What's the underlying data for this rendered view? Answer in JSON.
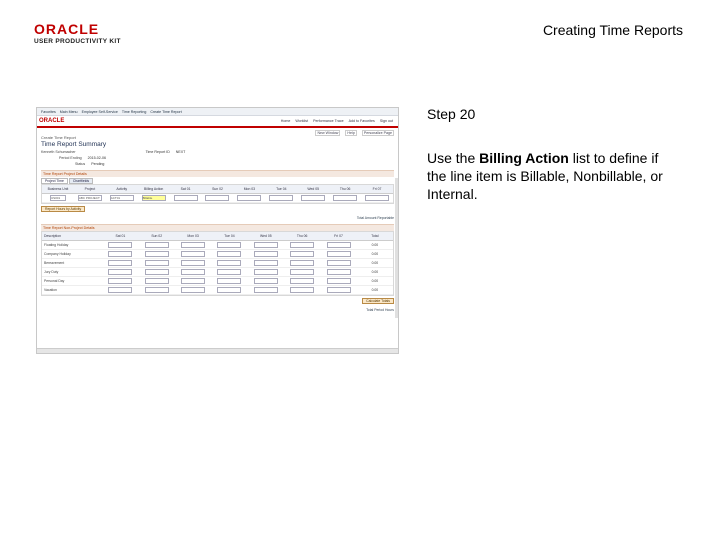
{
  "slide": {
    "title": "Creating Time Reports",
    "logo_word": "ORACLE",
    "logo_sub": "USER PRODUCTIVITY KIT",
    "step_label": "Step 20",
    "instruction_before": "Use the ",
    "instruction_bold": "Billing Action",
    "instruction_after": " list to define if the line item is Billable, Nonbillable, or Internal."
  },
  "app": {
    "topnav": [
      "Favorites",
      "Main Menu",
      "Employee Self-Service",
      "Time Reporting",
      "Create Time Report"
    ],
    "logo": "ORACLE",
    "menu_links": [
      "Home",
      "Worklist",
      "Performance Trace",
      "Add to Favorites",
      "Sign out"
    ],
    "util_links": [
      "New Window",
      "Help",
      "Personalize Page"
    ],
    "page_subtitle": "Create Time Report",
    "page_title": "Time Report Summary",
    "employee_label": "Kenneth Schumacher",
    "report_id_label": "Time Report ID",
    "report_id_value": "NEXT",
    "date_label": "Period Ending",
    "date_value": "2015-02-06",
    "status_label": "Status",
    "status_value": "Pending",
    "section1": "Time Report Project Details",
    "tabs": [
      "Project Time",
      "Chartfields"
    ],
    "time_columns": [
      "Business Unit",
      "Project",
      "Activity",
      "Billing Action",
      "Sat 01",
      "Sun 02",
      "Mon 03",
      "Tue 04",
      "Wed 05",
      "Thu 06",
      "Fri 07"
    ],
    "project_row": {
      "bu": "US001",
      "project": "ABC PROJECT",
      "activity": "ACT01",
      "billing": "Billable"
    },
    "add_button": "Report Hours by Activity",
    "total_note": "Total Amount Reportable",
    "section2": "Time Report Non-Project Details",
    "np_columns": [
      "Description",
      "Sat 01",
      "Sun 02",
      "Mon 03",
      "Tue 04",
      "Wed 05",
      "Thu 06",
      "Fri 07",
      "Total"
    ],
    "np_rows": [
      {
        "label": "Floating Holiday",
        "total": "0.00"
      },
      {
        "label": "Company Holiday",
        "total": "0.00"
      },
      {
        "label": "Bereavement",
        "total": "0.00"
      },
      {
        "label": "Jury Duty",
        "total": "0.00"
      },
      {
        "label": "Personal Day",
        "total": "0.00"
      },
      {
        "label": "Vacation",
        "total": "0.00"
      }
    ],
    "calc_button": "Calculate Totals",
    "footer_note": "Total Period Hours"
  }
}
